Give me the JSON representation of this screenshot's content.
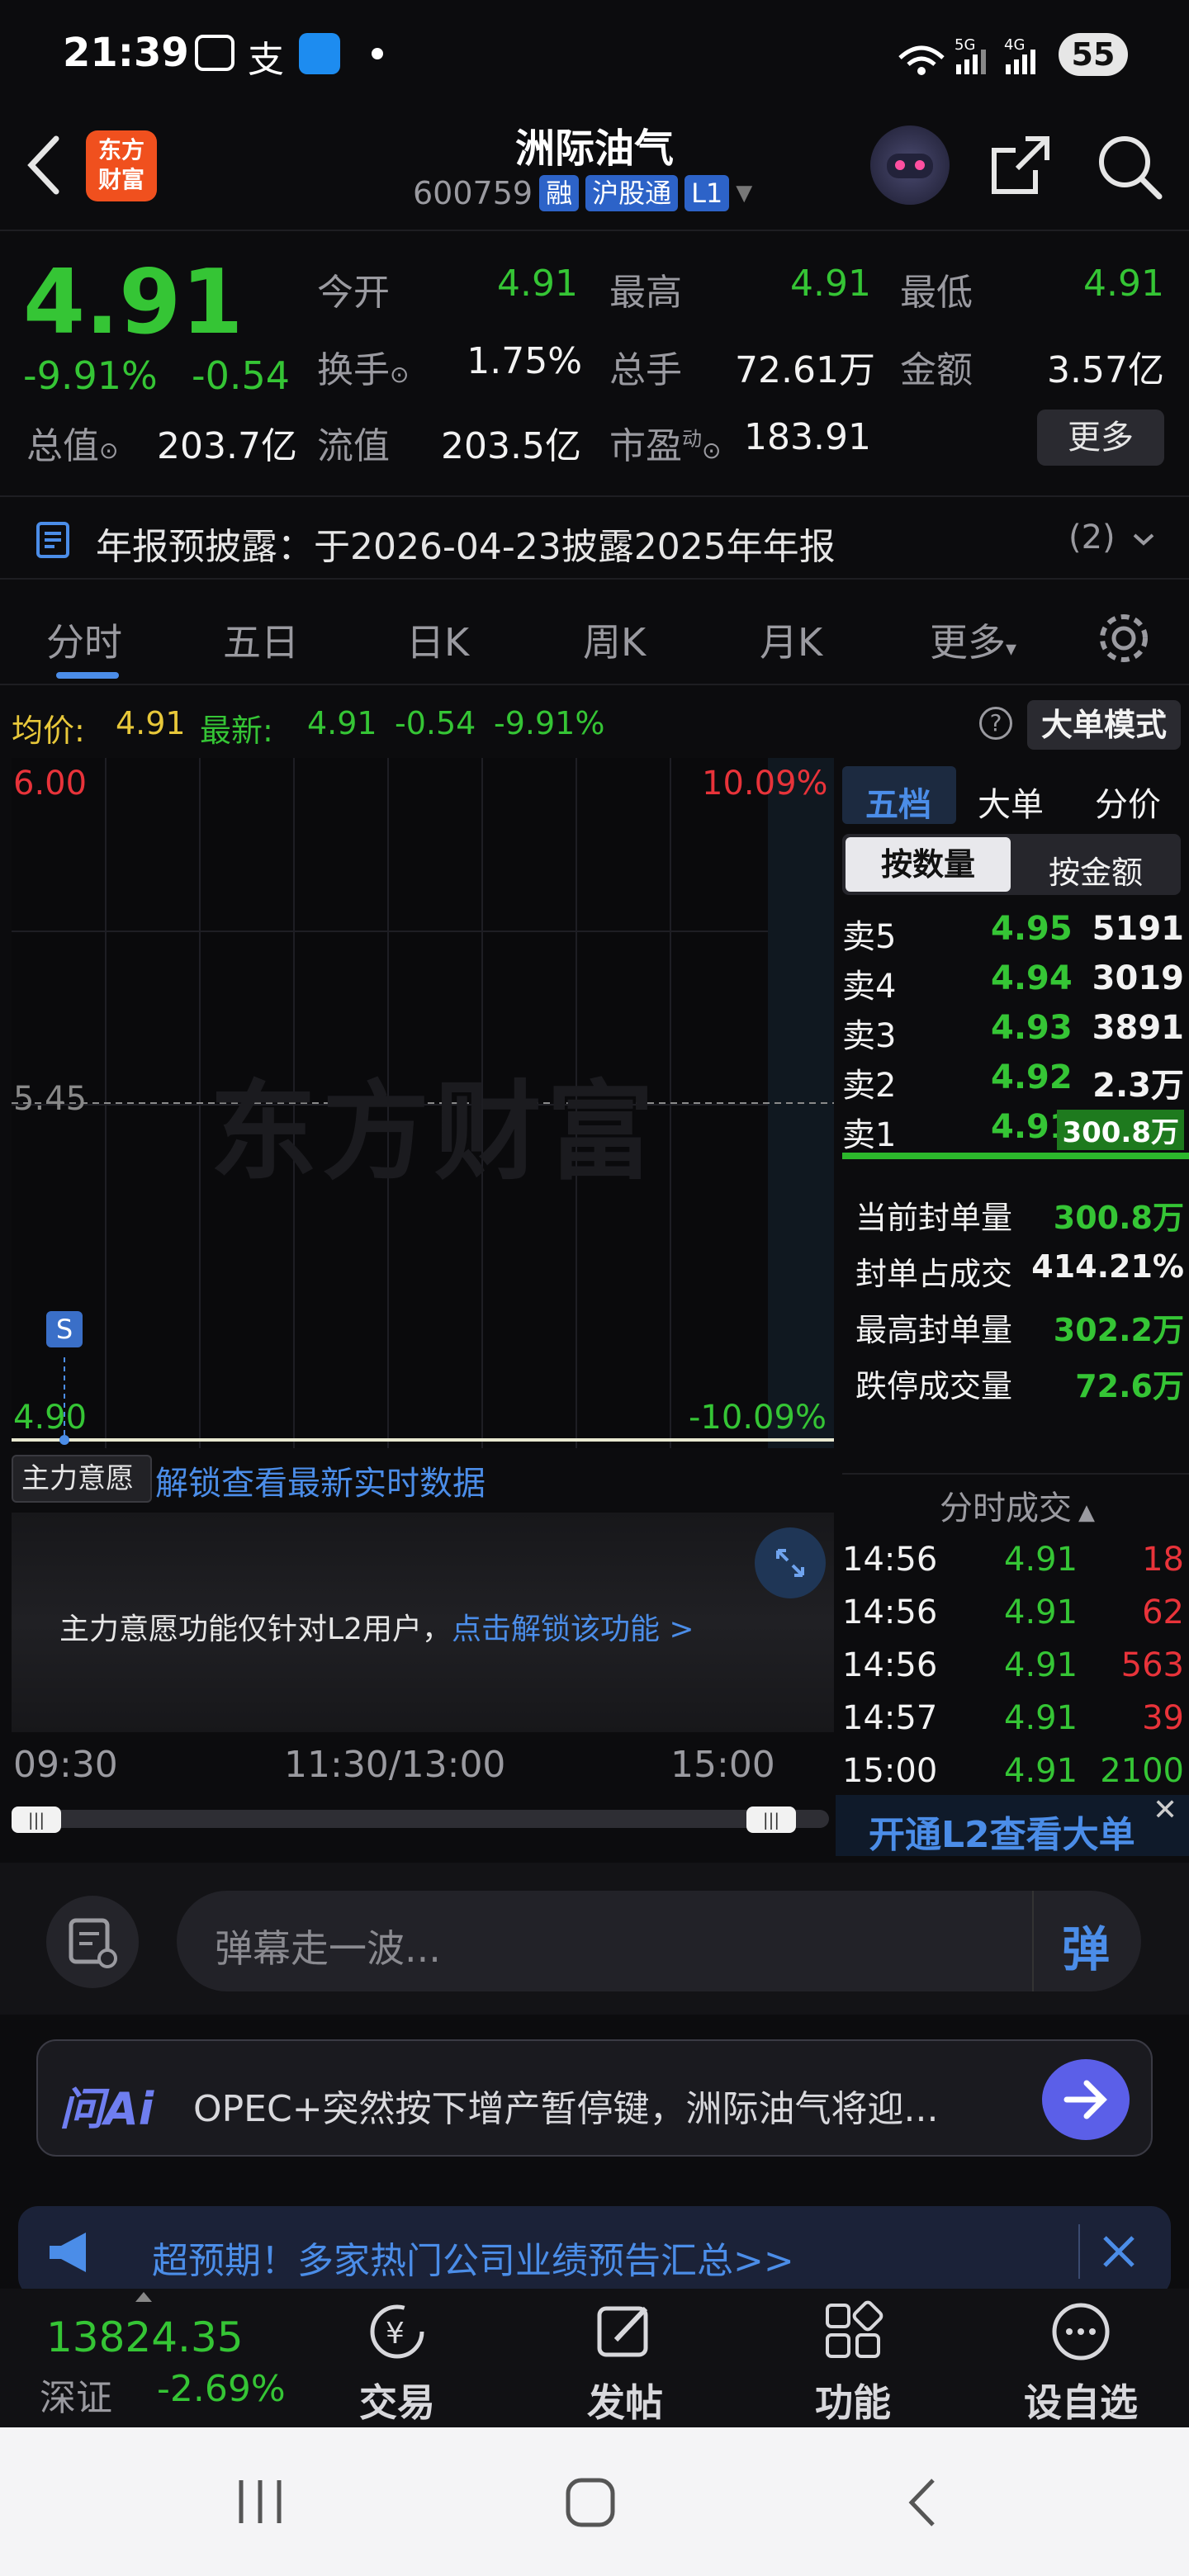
{
  "status_bar": {
    "time": "21:39",
    "battery": "55"
  },
  "header": {
    "logo_line1": "东方",
    "logo_line2": "财富",
    "title": "洲际油气",
    "code": "600759",
    "tag_margin": "融",
    "tag_connect": "沪股通",
    "tag_level": "L1"
  },
  "quote": {
    "price": "4.91",
    "change_pct": "-9.91%",
    "change_abs": "-0.54",
    "open_label": "今开",
    "open_value": "4.91",
    "high_label": "最高",
    "high_value": "4.91",
    "low_label": "最低",
    "low_value": "4.91",
    "turnover_label": "换手",
    "turnover_value": "1.75%",
    "volume_label": "总手",
    "volume_value": "72.61万",
    "amount_label": "金额",
    "amount_value": "3.57亿",
    "mktcap_label": "总值",
    "mktcap_value": "203.7亿",
    "float_label": "流值",
    "float_value": "203.5亿",
    "pe_label": "市盈",
    "pe_sup": "动",
    "pe_value": "183.91",
    "more_button": "更多"
  },
  "notice": {
    "text": "年报预披露：于2026-04-23披露2025年年报",
    "count": "(2)"
  },
  "tabs": [
    "分时",
    "五日",
    "日K",
    "周K",
    "月K",
    "更多"
  ],
  "info_row": {
    "avg_label": "均价:",
    "avg_value": "4.91",
    "latest_label": "最新:",
    "latest_value": "4.91",
    "latest_chg": "-0.54",
    "latest_pct": "-9.91%",
    "mode_button": "大单模式"
  },
  "chart": {
    "y_top": "6.00",
    "y_mid": "5.45",
    "y_bottom": "4.90",
    "pct_top": "10.09%",
    "pct_bottom": "-10.09%",
    "watermark": "东方财富",
    "marker": "S",
    "indicator_select": "主力意愿",
    "unlock_link": "解锁查看最新实时数据",
    "l2_notice": "主力意愿功能仅针对L2用户，",
    "l2_link": "点击解锁该功能 >",
    "time_start": "09:30",
    "time_mid": "11:30/13:00",
    "time_end": "15:00"
  },
  "order_book": {
    "tabs": [
      "五档",
      "大单",
      "分价"
    ],
    "mode_tabs": [
      "按数量",
      "按金额"
    ],
    "asks": [
      {
        "label": "卖5",
        "price": "4.95",
        "volume": "5191"
      },
      {
        "label": "卖4",
        "price": "4.94",
        "volume": "3019"
      },
      {
        "label": "卖3",
        "price": "4.93",
        "volume": "3891"
      },
      {
        "label": "卖2",
        "price": "4.92",
        "volume": "2.3万"
      },
      {
        "label": "卖1",
        "price": "4.91",
        "volume": "300.8万"
      }
    ],
    "stats": [
      {
        "label": "当前封单量",
        "value": "300.8万"
      },
      {
        "label": "封单占成交",
        "value": "414.21%"
      },
      {
        "label": "最高封单量",
        "value": "302.2万"
      },
      {
        "label": "跌停成交量",
        "value": "72.6万"
      }
    ],
    "trades_title": "分时成交",
    "trades": [
      {
        "time": "14:56",
        "price": "4.91",
        "vol": "18"
      },
      {
        "time": "14:56",
        "price": "4.91",
        "vol": "62"
      },
      {
        "time": "14:56",
        "price": "4.91",
        "vol": "563"
      },
      {
        "time": "14:57",
        "price": "4.91",
        "vol": "39"
      },
      {
        "time": "15:00",
        "price": "4.91",
        "vol": "2100"
      }
    ],
    "l2_banner": "开通L2查看大单"
  },
  "danmu": {
    "placeholder": "弹幕走一波...",
    "send": "弹"
  },
  "ai": {
    "logo": "问Ai",
    "text": "OPEC+突然按下增产暂停键，洲际油气将迎..."
  },
  "banner": {
    "text": "超预期！多家热门公司业绩预告汇总>>"
  },
  "bottom_nav": {
    "index_value": "13824.35",
    "index_name": "深证",
    "index_pct": "-2.69%",
    "items": [
      "交易",
      "发帖",
      "功能",
      "设自选"
    ]
  },
  "colors": {
    "down": "#35c535",
    "up": "#e8333a",
    "accent": "#4b8de8",
    "avg": "#e8c83a"
  }
}
